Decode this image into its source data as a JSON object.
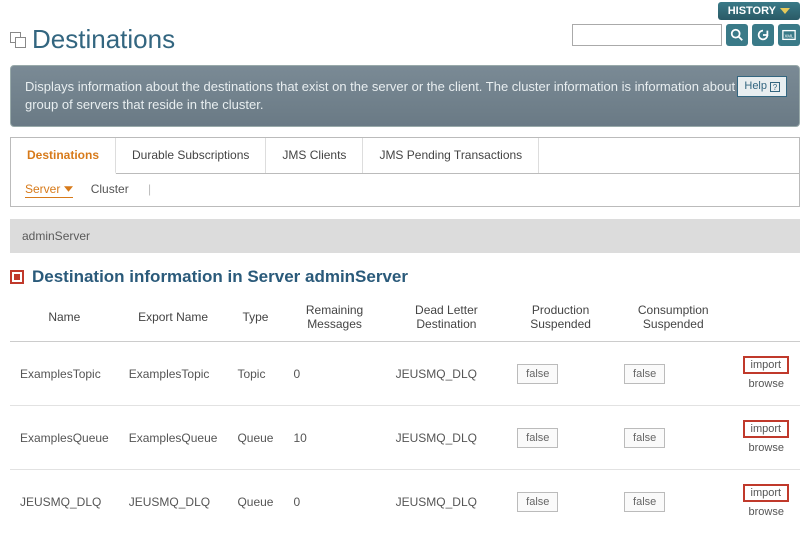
{
  "topbar": {
    "history_label": "HISTORY"
  },
  "page": {
    "title": "Destinations",
    "search_placeholder": ""
  },
  "banner": {
    "text": "Displays information about the destinations that exist on the server or the client. The cluster information is information about the group of servers that reside in the cluster.",
    "help_label": "Help"
  },
  "tabs": {
    "items": [
      {
        "label": "Destinations"
      },
      {
        "label": "Durable Subscriptions"
      },
      {
        "label": "JMS Clients"
      },
      {
        "label": "JMS Pending Transactions"
      }
    ],
    "sub": {
      "server_label": "Server",
      "cluster_label": "Cluster"
    }
  },
  "context": {
    "server_name": "adminServer"
  },
  "section": {
    "title": "Destination information in Server adminServer"
  },
  "table": {
    "headers": {
      "name": "Name",
      "export_name": "Export Name",
      "type": "Type",
      "remaining": "Remaining Messages",
      "dld": "Dead Letter Destination",
      "prod_susp": "Production Suspended",
      "cons_susp": "Consumption Suspended"
    },
    "rows": [
      {
        "name": "ExamplesTopic",
        "export_name": "ExamplesTopic",
        "type": "Topic",
        "remaining": "0",
        "dld": "JEUSMQ_DLQ",
        "prod_susp": "false",
        "cons_susp": "false"
      },
      {
        "name": "ExamplesQueue",
        "export_name": "ExamplesQueue",
        "type": "Queue",
        "remaining": "10",
        "dld": "JEUSMQ_DLQ",
        "prod_susp": "false",
        "cons_susp": "false"
      },
      {
        "name": "JEUSMQ_DLQ",
        "export_name": "JEUSMQ_DLQ",
        "type": "Queue",
        "remaining": "0",
        "dld": "JEUSMQ_DLQ",
        "prod_susp": "false",
        "cons_susp": "false"
      }
    ],
    "actions": {
      "import_label": "import",
      "browse_label": "browse"
    }
  }
}
